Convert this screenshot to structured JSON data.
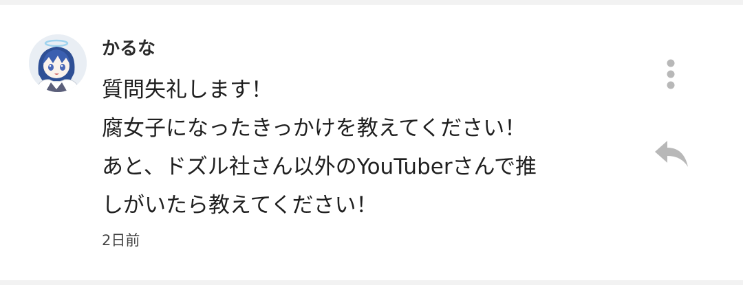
{
  "comment": {
    "author": "かるな",
    "lines": [
      "質問失礼します！",
      "腐女子になったきっかけを教えてください！",
      "あと、ドズル社さん以外のYouTuberさんで推",
      "しがいたら教えてください！"
    ],
    "timestamp": "2日前"
  },
  "icons": {
    "menu": "more-vert-icon",
    "reply": "reply-icon"
  },
  "colors": {
    "background": "#f2f2f2",
    "card": "#ffffff",
    "icon": "#b8b8b8",
    "text": "#1f1f1f"
  }
}
